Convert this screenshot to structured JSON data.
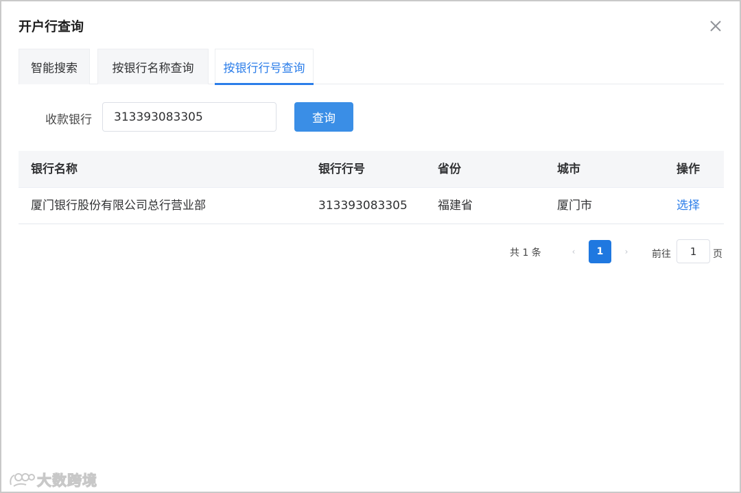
{
  "dialog": {
    "title": "开户行查询",
    "close_icon": "close-icon"
  },
  "tabs": [
    {
      "label": "智能搜索",
      "active": false
    },
    {
      "label": "按银行名称查询",
      "active": false
    },
    {
      "label": "按银行行号查询",
      "active": true
    }
  ],
  "form": {
    "label": "收款银行",
    "input_value": "313393083305",
    "query_label": "查询"
  },
  "table": {
    "columns": [
      "银行名称",
      "银行行号",
      "省份",
      "城市",
      "操作"
    ],
    "rows": [
      {
        "name": "厦门银行股份有限公司总行营业部",
        "code": "313393083305",
        "province": "福建省",
        "city": "厦门市",
        "action": "选择"
      }
    ]
  },
  "pagination": {
    "total": "共 1 条",
    "current_page": "1",
    "goto_label": "前往",
    "goto_value": "1",
    "unit": "页"
  },
  "watermark": {
    "text": "大数跨境"
  },
  "colors": {
    "accent": "#2b7de9",
    "button": "#3a8ee6",
    "header_bg": "#f5f6f8"
  }
}
